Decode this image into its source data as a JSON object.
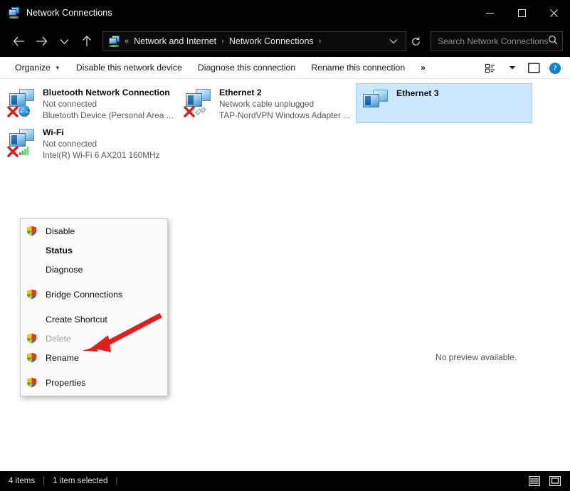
{
  "window": {
    "title": "Network Connections",
    "icon": "network-connections-icon",
    "controls": {
      "minimize": "minimize-icon",
      "maximize": "maximize-icon",
      "close": "close-icon"
    }
  },
  "addressbar": {
    "back": "back-arrow-icon",
    "forward": "forward-arrow-icon",
    "recent": "chevron-down-icon",
    "up": "up-arrow-icon",
    "breadcrumb": {
      "overflow": "«",
      "items": [
        "Network and Internet",
        "Network Connections"
      ],
      "separator": "›"
    },
    "dropdown": "chevron-down-icon",
    "refresh": "refresh-icon",
    "search": {
      "placeholder": "Search Network Connections",
      "icon": "search-icon"
    }
  },
  "commandbar": {
    "items": [
      {
        "label": "Organize",
        "has_caret": true
      },
      {
        "label": "Disable this network device",
        "has_caret": false
      },
      {
        "label": "Diagnose this connection",
        "has_caret": false
      },
      {
        "label": "Rename this connection",
        "has_caret": false
      }
    ],
    "overflow": "»",
    "view_icon": "layout-view-icon",
    "view_caret": "chevron-down-icon",
    "preview_pane_icon": "preview-pane-icon",
    "help_icon": "help-icon",
    "help_glyph": "?"
  },
  "connections": [
    {
      "name": "Bluetooth Network Connection",
      "status": "Not connected",
      "device": "Bluetooth Device (Personal Area ...",
      "badge": "bluetooth-icon",
      "disconnected": true,
      "selected": false
    },
    {
      "name": "Ethernet 2",
      "status": "Network cable unplugged",
      "device": "TAP-NordVPN Windows Adapter ...",
      "badge": "unplugged-cable-icon",
      "disconnected": true,
      "selected": false
    },
    {
      "name": "Ethernet 3",
      "status": "",
      "device": "",
      "badge": "none",
      "disconnected": false,
      "selected": true
    },
    {
      "name": "Wi-Fi",
      "status": "Not connected",
      "device": "Intel(R) Wi-Fi 6 AX201 160MHz",
      "badge": "wifi-signal-icon",
      "disconnected": true,
      "selected": false
    }
  ],
  "preview": {
    "message": "No preview available."
  },
  "context_menu": {
    "items": [
      {
        "label": "Disable",
        "shield": true,
        "bold": false,
        "disabled": false,
        "gap": false
      },
      {
        "label": "Status",
        "shield": false,
        "bold": true,
        "disabled": false,
        "gap": false
      },
      {
        "label": "Diagnose",
        "shield": false,
        "bold": false,
        "disabled": false,
        "gap": false
      },
      {
        "label": "Bridge Connections",
        "shield": true,
        "bold": false,
        "disabled": false,
        "gap": true
      },
      {
        "label": "Create Shortcut",
        "shield": false,
        "bold": false,
        "disabled": false,
        "gap": true
      },
      {
        "label": "Delete",
        "shield": true,
        "bold": false,
        "disabled": true,
        "gap": false
      },
      {
        "label": "Rename",
        "shield": true,
        "bold": false,
        "disabled": false,
        "gap": false
      },
      {
        "label": "Properties",
        "shield": true,
        "bold": false,
        "disabled": false,
        "gap": true
      }
    ]
  },
  "annotation": {
    "arrow": "red-arrow-pointing-to-properties",
    "color": "#e02020"
  },
  "statusbar": {
    "item_count": "4 items",
    "selection": "1 item selected",
    "sep": "|",
    "details_view_icon": "details-view-icon",
    "large_icons_view_icon": "large-icons-view-icon"
  },
  "colors": {
    "chrome": "#000000",
    "content": "#ffffff",
    "selection": "#cce8ff",
    "accent": "#0a84d8",
    "annotation": "#e02020"
  }
}
